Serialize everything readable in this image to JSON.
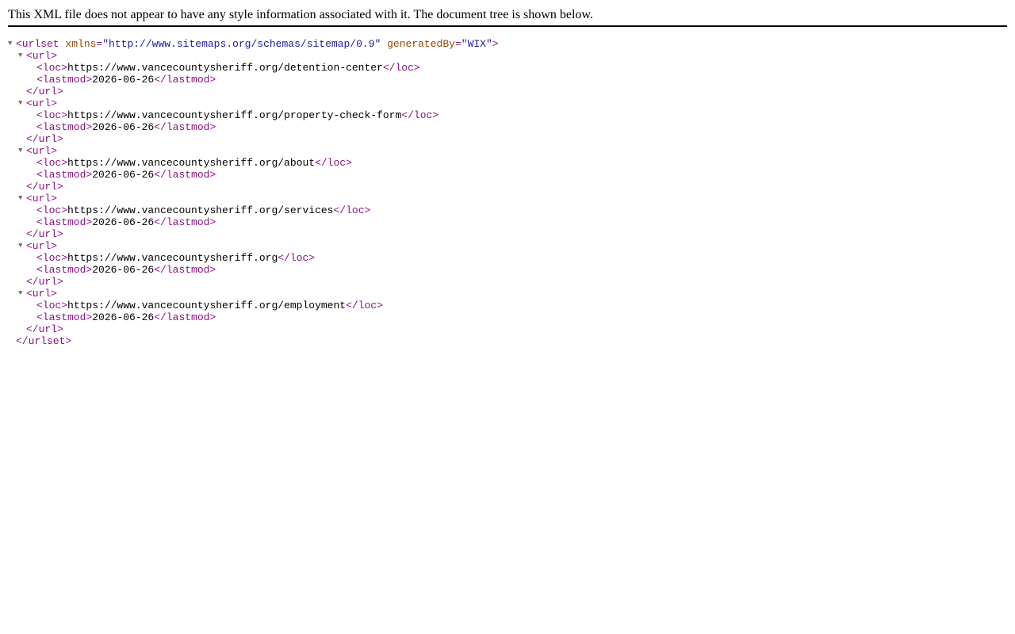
{
  "notice": "This XML file does not appear to have any style information associated with it. The document tree is shown below.",
  "root": {
    "open_tag_start": "<urlset",
    "attributes": [
      {
        "name": "xmlns",
        "value": "\"http://www.sitemaps.org/schemas/sitemap/0.9\""
      },
      {
        "name": "generatedBy",
        "value": "\"WIX\""
      }
    ],
    "open_tag_end": ">",
    "close_tag": "</urlset>"
  },
  "url_open": "<url>",
  "url_close": "</url>",
  "loc_open": "<loc>",
  "loc_close": "</loc>",
  "lastmod_open": "<lastmod>",
  "lastmod_close": "</lastmod>",
  "toggle_glyph": "▼",
  "urls": [
    {
      "loc": "https://www.vancecountysheriff.org/detention-center",
      "lastmod": "2026-06-26"
    },
    {
      "loc": "https://www.vancecountysheriff.org/property-check-form",
      "lastmod": "2026-06-26"
    },
    {
      "loc": "https://www.vancecountysheriff.org/about",
      "lastmod": "2026-06-26"
    },
    {
      "loc": "https://www.vancecountysheriff.org/services",
      "lastmod": "2026-06-26"
    },
    {
      "loc": "https://www.vancecountysheriff.org",
      "lastmod": "2026-06-26"
    },
    {
      "loc": "https://www.vancecountysheriff.org/employment",
      "lastmod": "2026-06-26"
    }
  ],
  "colors": {
    "tag": "#881280",
    "attr_name": "#994500",
    "attr_value": "#1a1aa6",
    "toggle": "#6e6e6e"
  }
}
